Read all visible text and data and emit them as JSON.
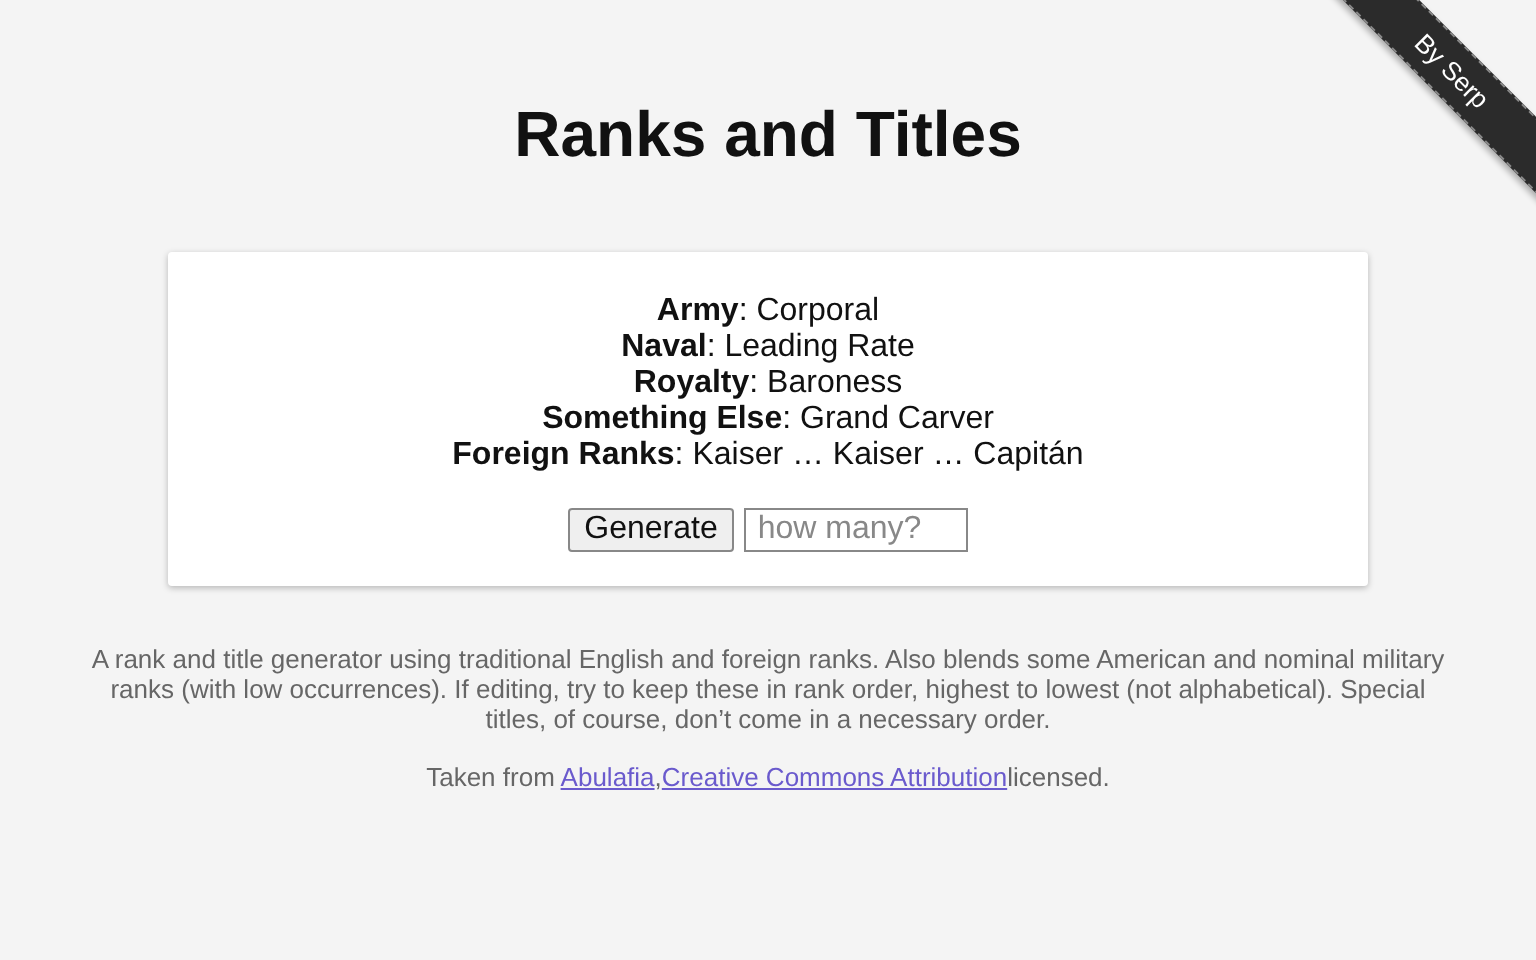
{
  "ribbon": {
    "text": "By Serp"
  },
  "title": "Ranks and Titles",
  "results": [
    "**Army**: Corporal",
    "**Naval**: Leading Rate",
    "**Royalty**: Baroness",
    "**Something Else**: Grand Carver",
    "**Foreign Ranks**: Kaiser … Kaiser … Capitán"
  ],
  "generate_button": "Generate",
  "count_field": {
    "placeholder": "how many?"
  },
  "description": "A rank and title generator using traditional English and foreign ranks. Also blends some American and nominal military ranks (with low occurrences). If editing, try to keep these in rank order, highest to lowest (not alphabetical). Special titles, of course, don’t come in a necessary order.",
  "credit": {
    "prefix": "Taken from",
    "links": [
      {
        "text": "Abulafia",
        "after": ","
      },
      {
        "text": "Creative Commons Attribution"
      }
    ],
    "suffix": "licensed."
  }
}
